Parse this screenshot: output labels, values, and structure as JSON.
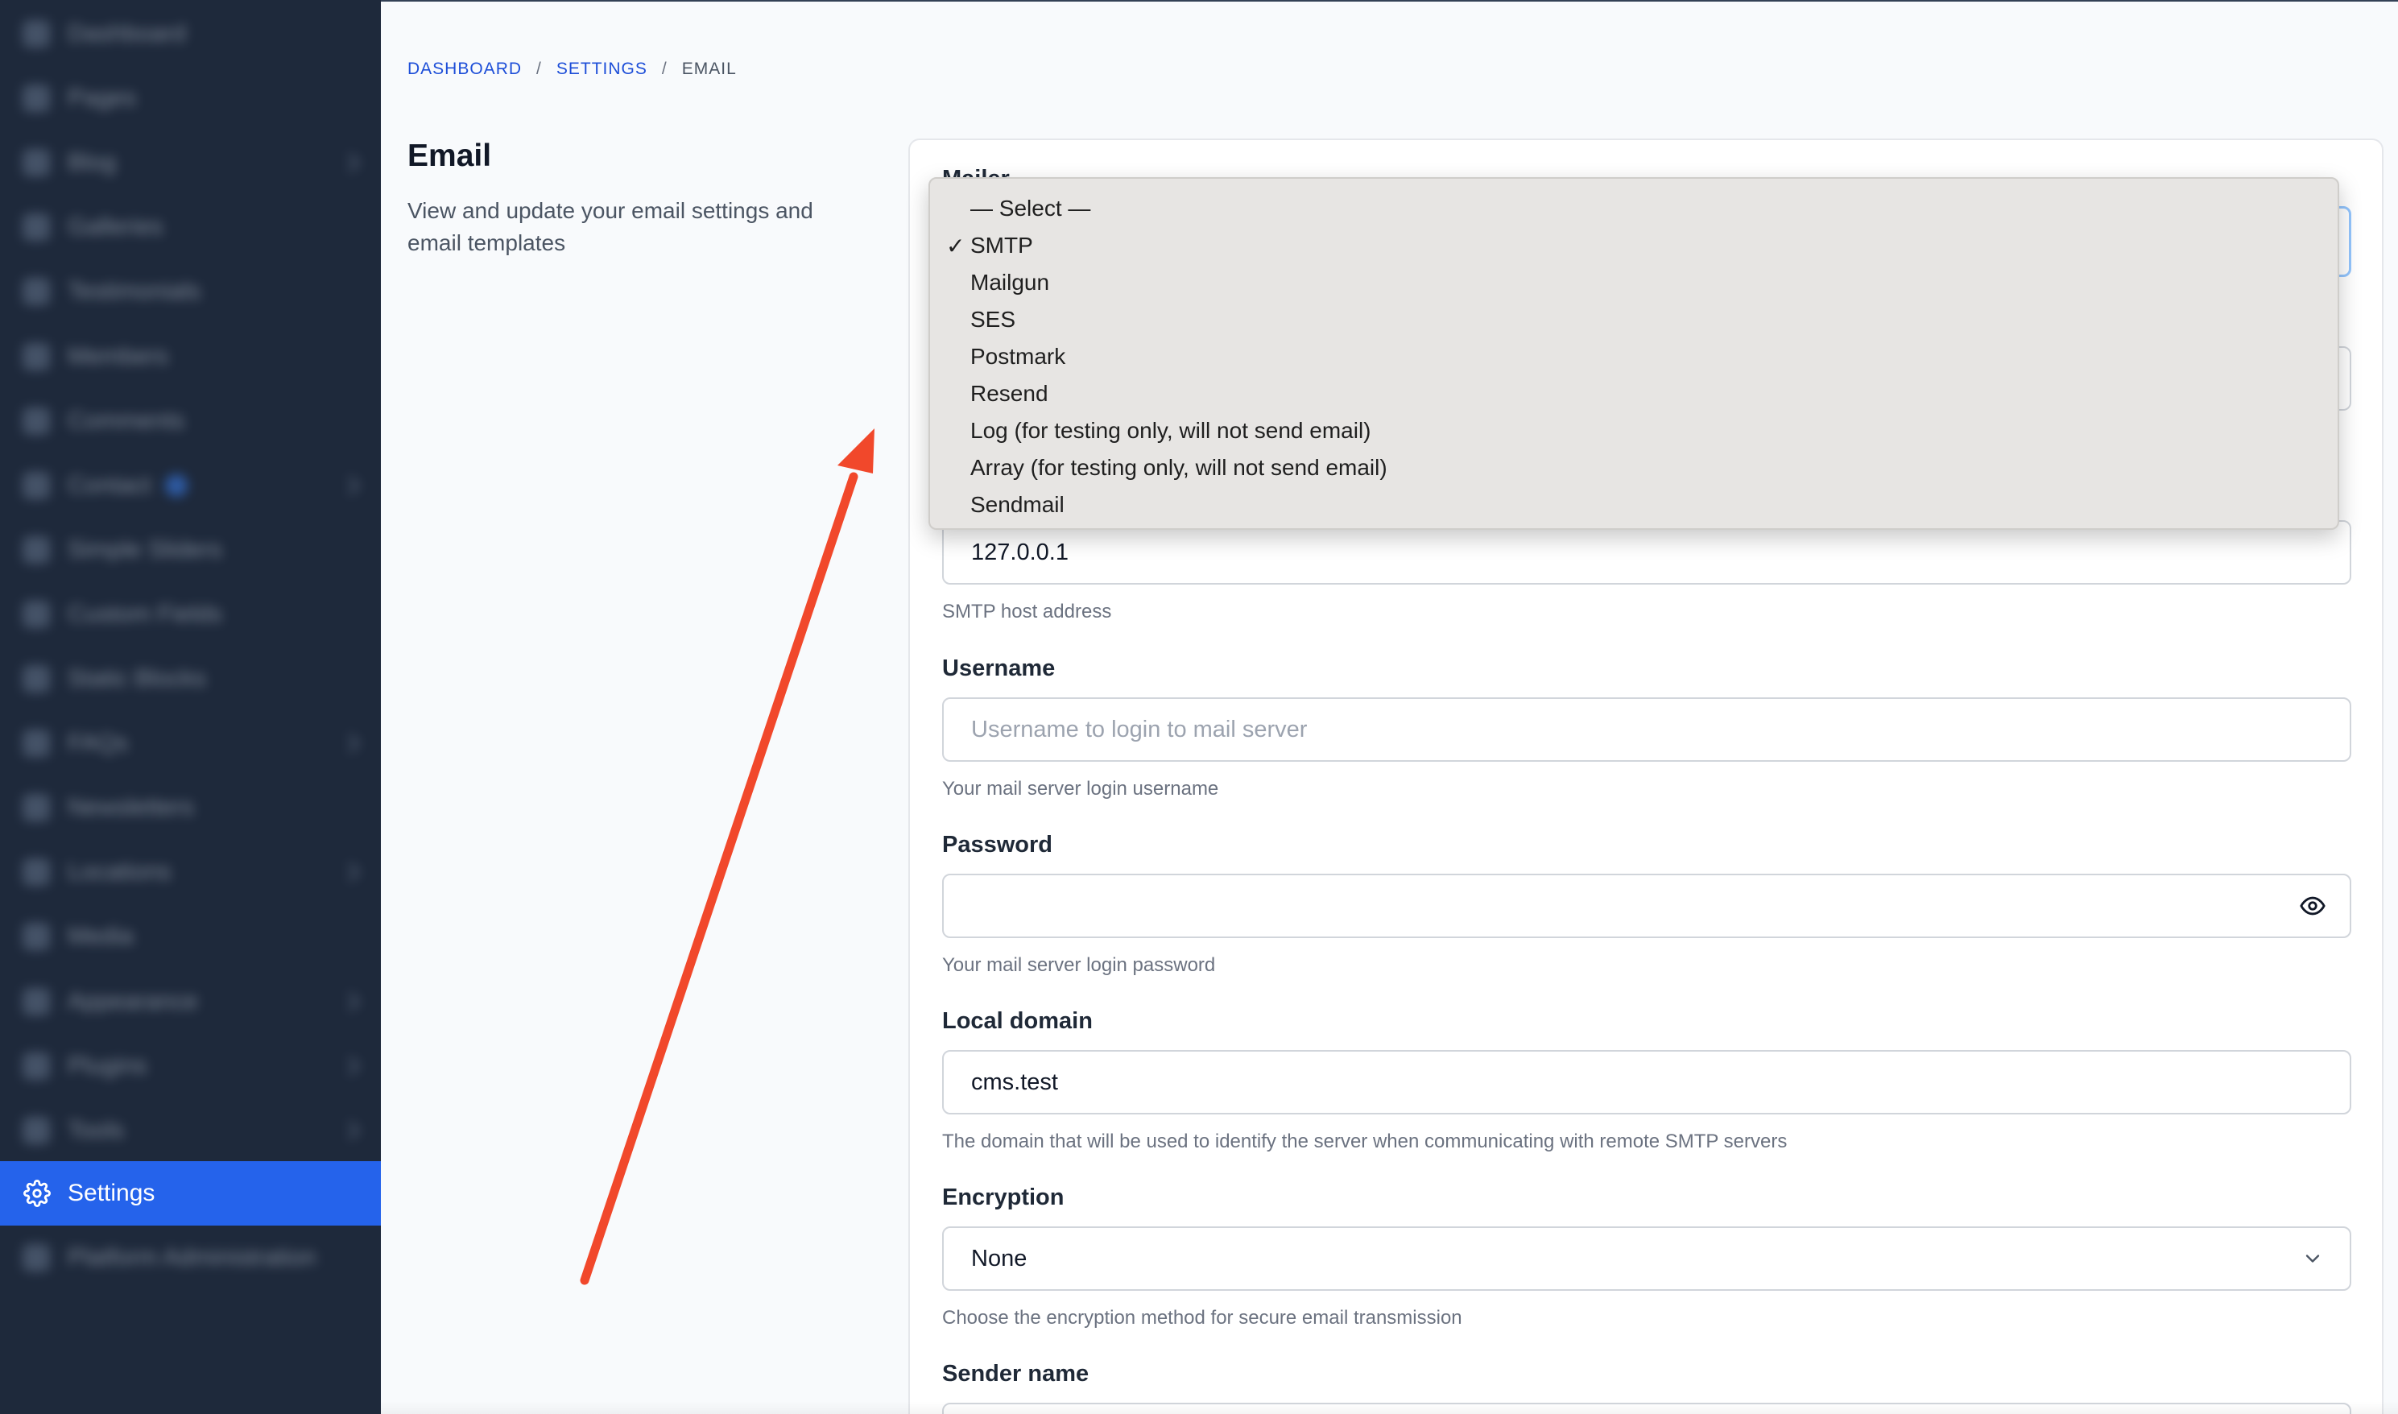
{
  "sidebar": {
    "items": [
      {
        "label": "Dashboard",
        "icon": "dashboard-icon",
        "chevron": false,
        "badge": false
      },
      {
        "label": "Pages",
        "icon": "pages-icon",
        "chevron": false,
        "badge": false
      },
      {
        "label": "Blog",
        "icon": "blog-icon",
        "chevron": true,
        "badge": false
      },
      {
        "label": "Galleries",
        "icon": "gallery-icon",
        "chevron": false,
        "badge": false
      },
      {
        "label": "Testimonials",
        "icon": "testimonials-icon",
        "chevron": false,
        "badge": false
      },
      {
        "label": "Members",
        "icon": "members-icon",
        "chevron": false,
        "badge": false
      },
      {
        "label": "Comments",
        "icon": "comments-icon",
        "chevron": false,
        "badge": false
      },
      {
        "label": "Contact",
        "icon": "contact-icon",
        "chevron": true,
        "badge": true
      },
      {
        "label": "Simple Sliders",
        "icon": "slider-icon",
        "chevron": false,
        "badge": false
      },
      {
        "label": "Custom Fields",
        "icon": "fields-icon",
        "chevron": false,
        "badge": false
      },
      {
        "label": "Static Blocks",
        "icon": "blocks-icon",
        "chevron": false,
        "badge": false
      },
      {
        "label": "FAQs",
        "icon": "faq-icon",
        "chevron": true,
        "badge": false
      },
      {
        "label": "Newsletters",
        "icon": "newsletter-icon",
        "chevron": false,
        "badge": false
      },
      {
        "label": "Locations",
        "icon": "location-icon",
        "chevron": true,
        "badge": false
      },
      {
        "label": "Media",
        "icon": "media-icon",
        "chevron": false,
        "badge": false
      },
      {
        "label": "Appearance",
        "icon": "appearance-icon",
        "chevron": true,
        "badge": false
      },
      {
        "label": "Plugins",
        "icon": "plugins-icon",
        "chevron": true,
        "badge": false
      },
      {
        "label": "Tools",
        "icon": "tools-icon",
        "chevron": true,
        "badge": false
      }
    ],
    "active": {
      "label": "Settings",
      "icon": "gear-icon"
    },
    "after": {
      "label": "Platform Administration",
      "icon": "admin-icon"
    },
    "active_color": "#2563eb",
    "bg_color": "#1e293b"
  },
  "breadcrumb": {
    "items": [
      "DASHBOARD",
      "SETTINGS"
    ],
    "current": "EMAIL",
    "separator": "/"
  },
  "section": {
    "title": "Email",
    "description": "View and update your email settings and email templates"
  },
  "form": {
    "mailer_label": "Mailer",
    "host": {
      "value": "127.0.0.1",
      "help": "SMTP host address"
    },
    "username": {
      "label": "Username",
      "placeholder": "Username to login to mail server",
      "help": "Your mail server login username"
    },
    "password": {
      "label": "Password",
      "value": "",
      "help": "Your mail server login password",
      "icon": "eye-icon"
    },
    "local_domain": {
      "label": "Local domain",
      "value": "cms.test",
      "help": "The domain that will be used to identify the server when communicating with remote SMTP servers"
    },
    "encryption": {
      "label": "Encryption",
      "value": "None",
      "help": "Choose the encryption method for secure email transmission",
      "icon": "chevron-down-icon"
    },
    "sender_name": {
      "label": "Sender name"
    }
  },
  "mailer_dropdown": {
    "options": [
      "— Select —",
      "SMTP",
      "Mailgun",
      "SES",
      "Postmark",
      "Resend",
      "Log (for testing only, will not send email)",
      "Array (for testing only, will not send email)",
      "Sendmail"
    ],
    "selected": "SMTP",
    "check": "✓"
  },
  "annotation": {
    "arrow_color": "#f1482b"
  }
}
